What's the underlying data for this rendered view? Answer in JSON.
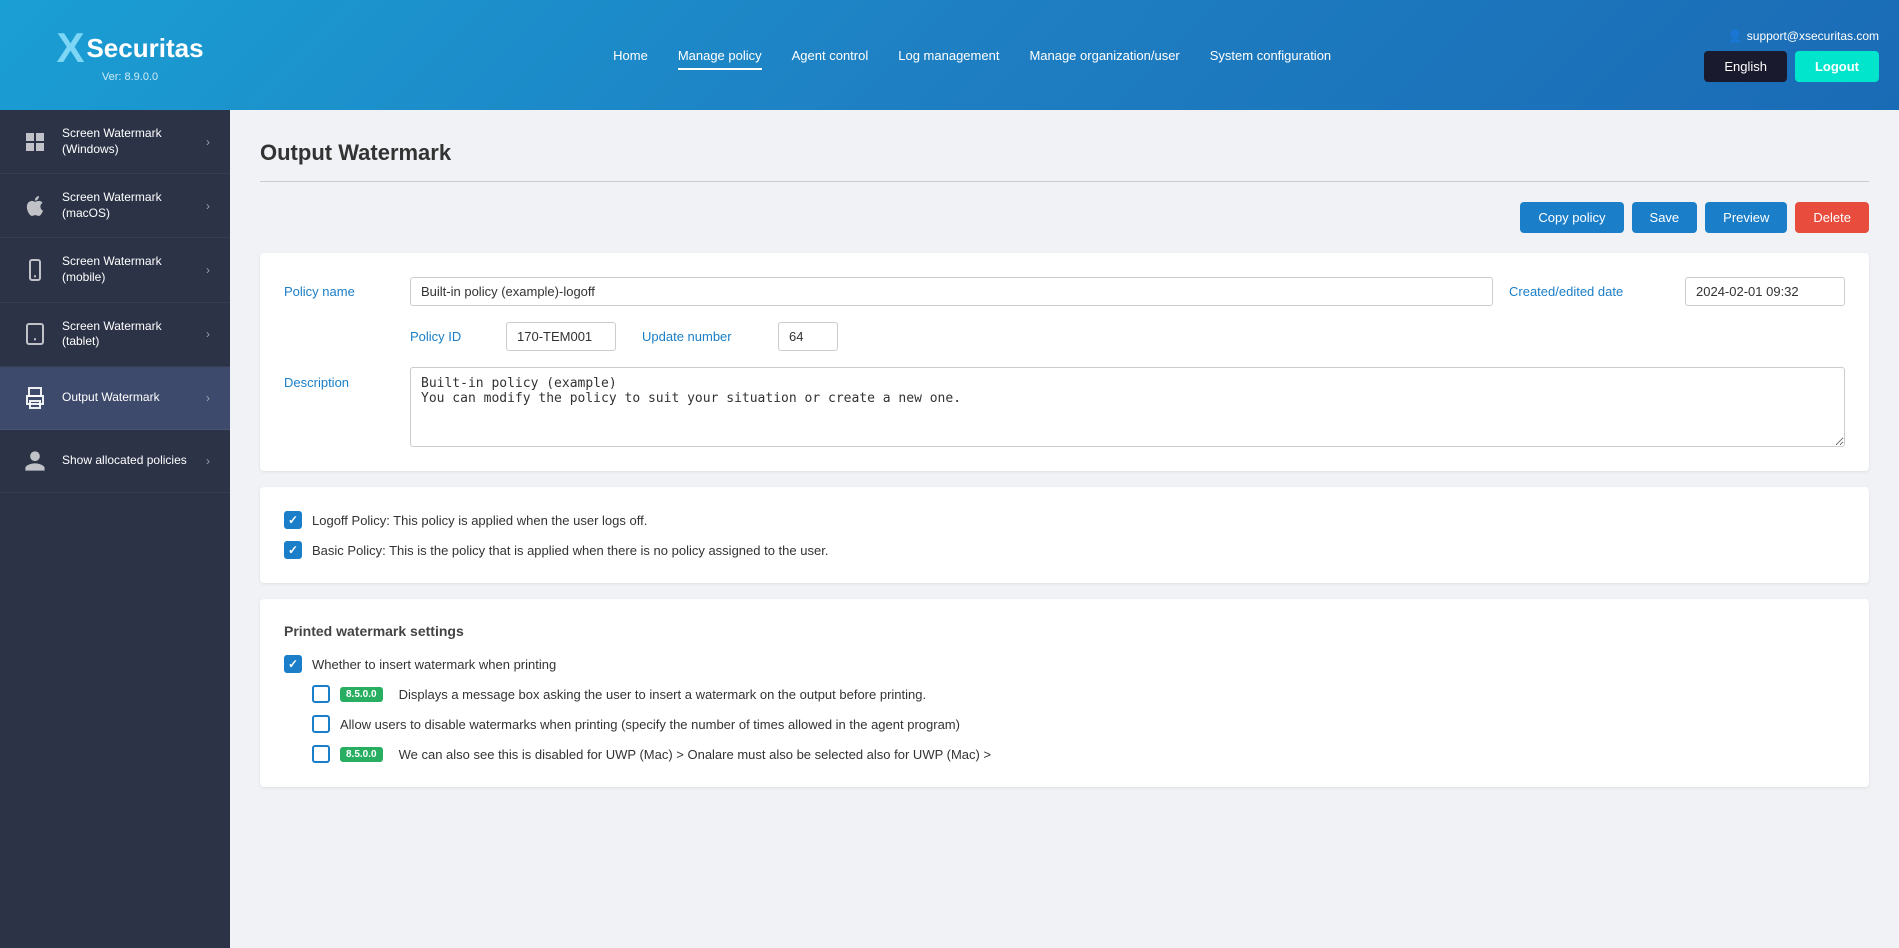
{
  "header": {
    "logo_x": "X",
    "logo_brand": "Securitas",
    "version": "Ver: 8.9.0.0",
    "support_email": "support@xsecuritas.com",
    "language_button": "English",
    "logout_button": "Logout",
    "nav": [
      {
        "label": "Home",
        "active": false
      },
      {
        "label": "Manage policy",
        "active": true
      },
      {
        "label": "Agent control",
        "active": false
      },
      {
        "label": "Log management",
        "active": false
      },
      {
        "label": "Manage organization/user",
        "active": false
      },
      {
        "label": "System configuration",
        "active": false
      }
    ]
  },
  "sidebar": {
    "items": [
      {
        "label": "Screen Watermark\n(Windows)",
        "active": false
      },
      {
        "label": "Screen Watermark\n(macOS)",
        "active": false
      },
      {
        "label": "Screen Watermark\n(mobile)",
        "active": false
      },
      {
        "label": "Screen Watermark\n(tablet)",
        "active": false
      },
      {
        "label": "Output Watermark",
        "active": true
      },
      {
        "label": "Show allocated policies",
        "active": false
      }
    ]
  },
  "page": {
    "title": "Output Watermark"
  },
  "toolbar": {
    "copy_policy": "Copy policy",
    "save": "Save",
    "preview": "Preview",
    "delete": "Delete"
  },
  "policy_form": {
    "policy_name_label": "Policy name",
    "policy_name_value": "Built-in policy (example)-logoff",
    "created_date_label": "Created/edited date",
    "created_date_value": "2024-02-01 09:32",
    "policy_id_label": "Policy ID",
    "policy_id_value": "170-TEM001",
    "update_number_label": "Update number",
    "update_number_value": "64",
    "description_label": "Description",
    "description_value": "Built-in policy (example)\nYou can modify the policy to suit your situation or create a new one."
  },
  "checkboxes": {
    "logoff_policy_checked": true,
    "logoff_policy_label": "Logoff Policy: This policy is applied when the user logs off.",
    "basic_policy_checked": true,
    "basic_policy_label": "Basic Policy: This is the policy that is applied when there is no policy assigned to the user."
  },
  "printed_watermark": {
    "section_title": "Printed watermark settings",
    "insert_watermark_checked": true,
    "insert_watermark_label": "Whether to insert watermark when printing",
    "displays_message_badge": "8.5.0.0",
    "displays_message_checked": false,
    "displays_message_label": "Displays a message box asking the user to insert a watermark on the output before printing.",
    "allow_disable_checked": false,
    "allow_disable_label": "Allow users to disable watermarks when printing (specify the number of times allowed in the agent program)",
    "another_badge": "8.5.0.0",
    "another_checked": false,
    "another_label": "We can also see this is disabled for UWP (Mac) > Onalare must also be selected also for UWP (Mac) >"
  }
}
